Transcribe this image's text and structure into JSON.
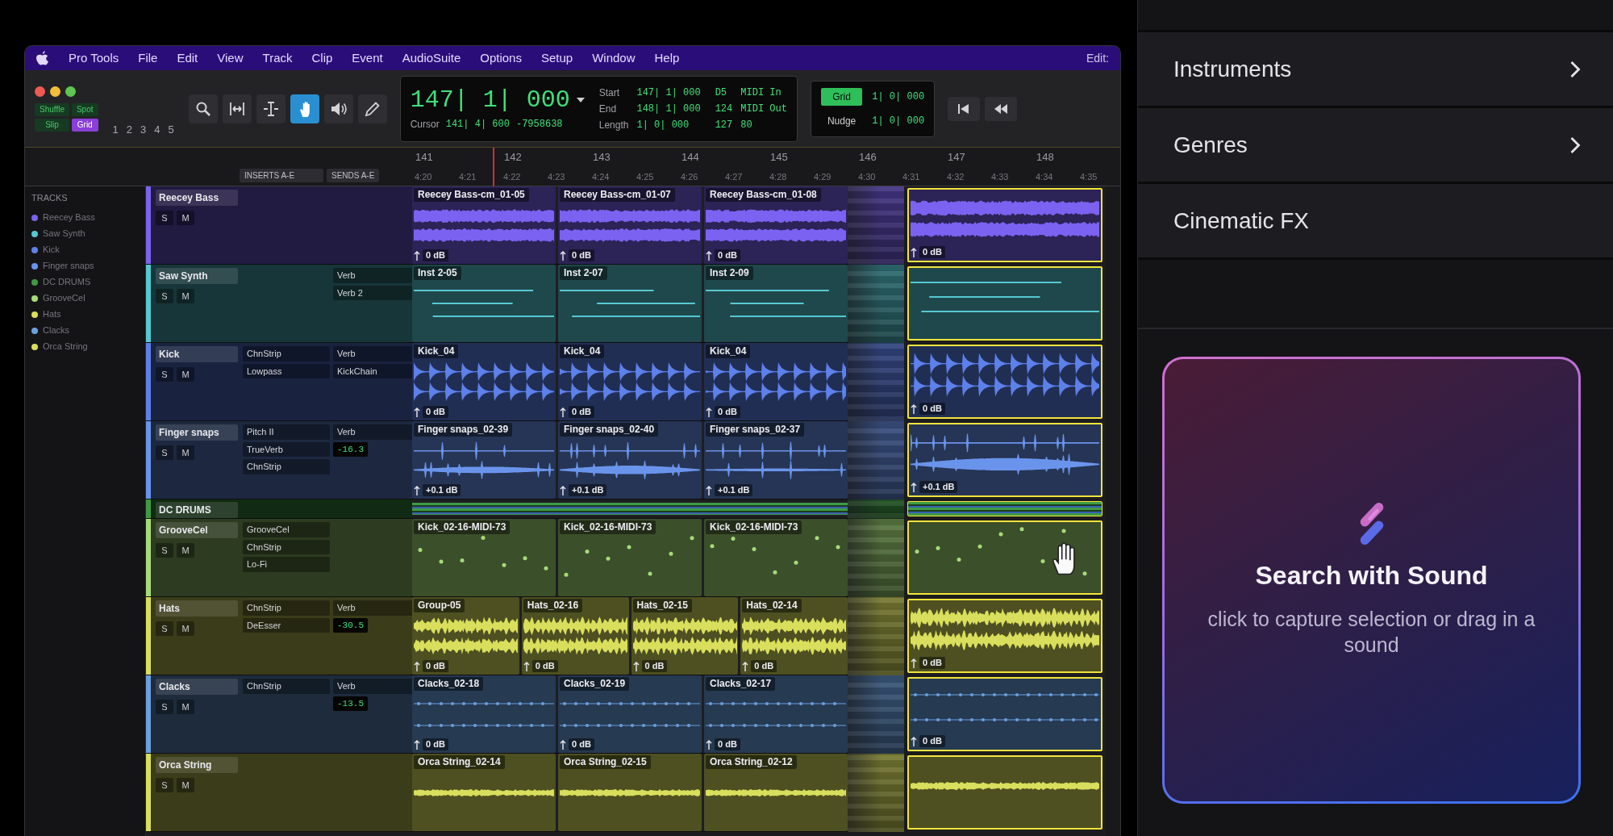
{
  "menu_bar": {
    "items": [
      "Pro Tools",
      "File",
      "Edit",
      "View",
      "Track",
      "Clip",
      "Event",
      "AudioSuite",
      "Options",
      "Setup",
      "Window",
      "Help"
    ],
    "window_title": "Edit:"
  },
  "toolbar": {
    "edit_modes": [
      {
        "label": "Shuffle",
        "selected": false
      },
      {
        "label": "Spot",
        "selected": false
      },
      {
        "label": "Slip",
        "selected": false
      },
      {
        "label": "Grid",
        "selected": true
      }
    ],
    "zoom_presets": [
      "1",
      "2",
      "3",
      "4",
      "5"
    ],
    "tools": [
      {
        "kind": "zoom",
        "selected": false
      },
      {
        "kind": "trim",
        "selected": false
      },
      {
        "kind": "selector",
        "selected": false
      },
      {
        "kind": "grabber",
        "selected": true
      },
      {
        "kind": "scrub",
        "selected": false
      },
      {
        "kind": "pencil",
        "selected": false
      }
    ]
  },
  "counter": {
    "main": "147| 1| 000",
    "cursor_label": "Cursor",
    "cursor": "141| 4| 600",
    "samples": "-7958638",
    "selection": [
      {
        "label": "Start",
        "value": "147| 1| 000"
      },
      {
        "label": "End",
        "value": "148| 1| 000"
      },
      {
        "label": "Length",
        "value": "1| 0| 000"
      }
    ],
    "midi_values": [
      "D5",
      "124",
      "127"
    ],
    "midi_labels": [
      "MIDI In",
      "MIDI Out"
    ],
    "midi_extra": "80"
  },
  "grid_nudge": [
    {
      "label": "Grid",
      "value": "1| 0| 000",
      "on": true
    },
    {
      "label": "Nudge",
      "value": "1| 0| 000",
      "on": false
    }
  ],
  "transport": [
    {
      "kind": "return_to_start"
    },
    {
      "kind": "rewind"
    }
  ],
  "ruler": {
    "bars": [
      "141",
      "142",
      "143",
      "144",
      "145",
      "146",
      "147",
      "148"
    ],
    "times": [
      "4:20",
      "4:21",
      "4:22",
      "4:23",
      "4:24",
      "4:25",
      "4:26",
      "4:27",
      "4:28",
      "4:29",
      "4:30",
      "4:31",
      "4:32",
      "4:33",
      "4:34",
      "4:35"
    ]
  },
  "track_list": {
    "header": "TRACKS",
    "items": [
      {
        "name": "Reecey Bass",
        "color": "#7b62f0"
      },
      {
        "name": "Saw Synth",
        "color": "#56c8d2"
      },
      {
        "name": "Kick",
        "color": "#5d80ea"
      },
      {
        "name": "Finger snaps",
        "color": "#6a94ec"
      },
      {
        "name": "DC DRUMS",
        "color": "#3f9a45"
      },
      {
        "name": "GrooveCel",
        "color": "#a6dc78"
      },
      {
        "name": "Hats",
        "color": "#d9de5c"
      },
      {
        "name": "Clacks",
        "color": "#6aa0e0"
      },
      {
        "name": "Orca String",
        "color": "#d9de5c"
      }
    ]
  },
  "column_headers": {
    "inserts": "INSERTS A-E",
    "sends": "SENDS A-E"
  },
  "tracks": [
    {
      "name": "Reecey Bass",
      "color": "#7b62f0",
      "kind": "sustained",
      "buttons": [
        "S",
        "M"
      ],
      "clips": [
        {
          "name": "Reecey Bass-cm_01-05",
          "gain": "0 dB"
        },
        {
          "name": "Reecey Bass-cm_01-07",
          "gain": "0 dB"
        },
        {
          "name": "Reecey Bass-cm_01-08",
          "gain": "0 dB"
        }
      ],
      "dragged": true,
      "drag_gain": "0 dB"
    },
    {
      "name": "Saw Synth",
      "color": "#56c8d2",
      "kind": "lines",
      "buttons": [
        "S",
        "M"
      ],
      "sends": [
        "Verb",
        "Verb 2"
      ],
      "clips": [
        {
          "name": "Inst 2-05"
        },
        {
          "name": "Inst 2-07"
        },
        {
          "name": "Inst 2-09"
        }
      ],
      "dragged": true
    },
    {
      "name": "Kick",
      "color": "#5d80ea",
      "kind": "percussive",
      "buttons": [
        "S",
        "M"
      ],
      "inserts": [
        "ChnStrip",
        "Lowpass"
      ],
      "sends": [
        "Verb",
        "KickChain"
      ],
      "clips": [
        {
          "name": "Kick_04",
          "gain": "0 dB"
        },
        {
          "name": "Kick_04",
          "gain": "0 dB"
        },
        {
          "name": "Kick_04",
          "gain": "0 dB"
        }
      ],
      "dragged": true,
      "drag_gain": "0 dB"
    },
    {
      "name": "Finger snaps",
      "color": "#6a94ec",
      "kind": "sparse",
      "buttons": [
        "S",
        "M"
      ],
      "inserts": [
        "Pitch II",
        "TrueVerb",
        "ChnStrip"
      ],
      "sends": [
        "Verb"
      ],
      "volume": "-16.3",
      "clips": [
        {
          "name": "Finger snaps_02-39",
          "gain": "+0.1 dB"
        },
        {
          "name": "Finger snaps_02-40",
          "gain": "+0.1 dB"
        },
        {
          "name": "Finger snaps_02-37",
          "gain": "+0.1 dB"
        }
      ],
      "dragged": true,
      "drag_gain": "+0.1 dB"
    },
    {
      "name": "DC DRUMS",
      "color": "#3f9a45",
      "kind": "folder",
      "dragged": true
    },
    {
      "name": "GrooveCel",
      "color": "#a6dc78",
      "kind": "notes",
      "buttons": [
        "S",
        "M"
      ],
      "inserts": [
        "GrooveCel",
        "ChnStrip",
        "Lo-Fi"
      ],
      "clips": [
        {
          "name": "Kick_02-16-MIDI-73"
        },
        {
          "name": "Kick_02-16-MIDI-73"
        },
        {
          "name": "Kick_02-16-MIDI-73"
        }
      ],
      "dragged": true,
      "hover_cursor": true
    },
    {
      "name": "Hats",
      "color": "#d9de5c",
      "kind": "dense",
      "buttons": [
        "S",
        "M"
      ],
      "inserts": [
        "ChnStrip",
        "DeEsser"
      ],
      "sends": [
        "Verb"
      ],
      "volume": "-30.5",
      "clips": [
        {
          "name": "Group-05",
          "gain": "0 dB"
        },
        {
          "name": "Hats_02-16",
          "gain": "0 dB"
        },
        {
          "name": "Hats_02-15",
          "gain": "0 dB"
        },
        {
          "name": "Hats_02-14",
          "gain": "0 dB"
        }
      ],
      "dragged": true,
      "drag_gain": "0 dB"
    },
    {
      "name": "Clacks",
      "color": "#6aa0e0",
      "kind": "pulse",
      "buttons": [
        "S",
        "M"
      ],
      "inserts": [
        "ChnStrip"
      ],
      "sends": [
        "Verb"
      ],
      "volume": "-13.5",
      "clips": [
        {
          "name": "Clacks_02-18",
          "gain": "0 dB"
        },
        {
          "name": "Clacks_02-19",
          "gain": "0 dB"
        },
        {
          "name": "Clacks_02-17",
          "gain": "0 dB"
        }
      ],
      "dragged": true,
      "drag_gain": "0 dB"
    },
    {
      "name": "Orca String",
      "color": "#d9de5c",
      "kind": "thin",
      "buttons": [
        "S",
        "M"
      ],
      "clips": [
        {
          "name": "Orca String_02-14"
        },
        {
          "name": "Orca String_02-15"
        },
        {
          "name": "Orca String_02-12"
        }
      ],
      "dragged": true
    }
  ],
  "side_panel": {
    "categories": [
      {
        "label": "Instruments",
        "submenu": true
      },
      {
        "label": "Genres",
        "submenu": true
      },
      {
        "label": "Cinematic FX",
        "submenu": false
      }
    ],
    "search_card": {
      "title": "Search with Sound",
      "hint": "click to capture selection or drag in a sound"
    }
  }
}
